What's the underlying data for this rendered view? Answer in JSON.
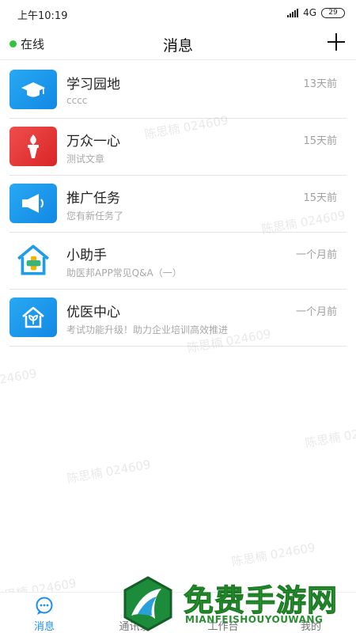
{
  "status_bar": {
    "time": "上午10:19",
    "network": "4G",
    "battery": "29"
  },
  "header": {
    "status": "在线",
    "title": "消息"
  },
  "messages": [
    {
      "title": "学习园地",
      "preview": "cccc",
      "time": "13天前",
      "icon": "graduation-cap-icon"
    },
    {
      "title": "万众一心",
      "preview": "测试文章",
      "time": "15天前",
      "icon": "torch-icon"
    },
    {
      "title": "推广任务",
      "preview": "您有新任务了",
      "time": "15天前",
      "icon": "megaphone-icon"
    },
    {
      "title": "小助手",
      "preview": "助医邦APP常见Q&A（一）",
      "time": "一个月前",
      "icon": "house-cross-icon"
    },
    {
      "title": "优医中心",
      "preview": "考试功能升级！助力企业培训高效推进",
      "time": "一个月前",
      "icon": "house-leaf-icon"
    }
  ],
  "watermark_text": "陈思楠 024609",
  "tabs": [
    {
      "label": "消息",
      "active": true
    },
    {
      "label": "通讯录",
      "active": false
    },
    {
      "label": "工作台",
      "active": false
    },
    {
      "label": "我的",
      "active": false
    }
  ],
  "promo": {
    "title": "免费手游网",
    "subtitle": "MIANFEISHOUYOUWANG"
  },
  "colors": {
    "accent": "#1e8fe8",
    "online": "#2fc43b",
    "promo_green": "#2ea636"
  }
}
